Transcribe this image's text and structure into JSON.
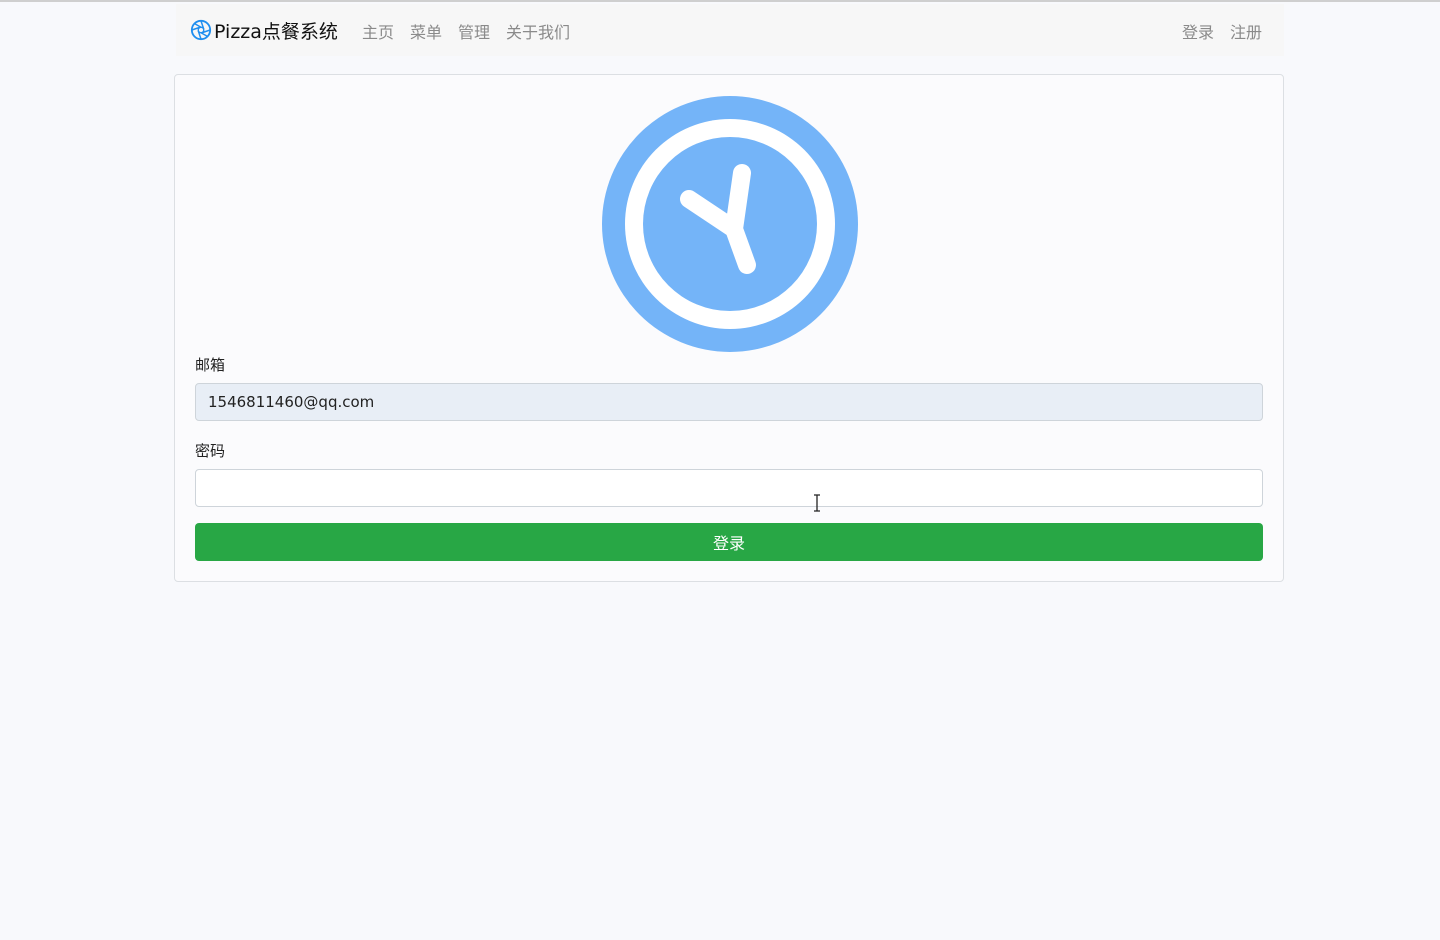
{
  "navbar": {
    "brand": "Pizza点餐系统",
    "links": [
      "主页",
      "菜单",
      "管理",
      "关于我们"
    ],
    "right_links": [
      "登录",
      "注册"
    ]
  },
  "form": {
    "email_label": "邮箱",
    "email_value": "1546811460@qq.com",
    "password_label": "密码",
    "password_value": "",
    "submit_label": "登录"
  },
  "icons": {
    "brand": "aperture-logo-icon",
    "hero": "clock-logo-icon",
    "cursor": "text-cursor-icon"
  },
  "colors": {
    "hero_blue": "#74b4f8",
    "button_green": "#28a745",
    "brand_blue": "#1f8ff0"
  }
}
